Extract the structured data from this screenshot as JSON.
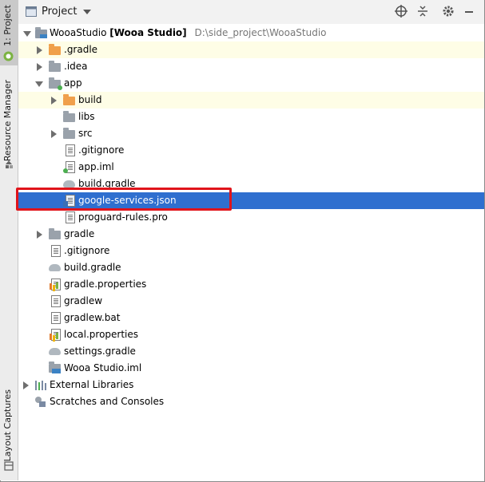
{
  "side_tabs": {
    "project": "1: Project",
    "resource_manager": "Resource Manager",
    "layout_captures": "Layout Captures"
  },
  "header": {
    "title": "Project",
    "dropdown_icon": "chevron-down-icon",
    "actions": [
      "crosshair-icon",
      "collapse-icon",
      "gear-icon",
      "minimize-icon"
    ]
  },
  "tree": {
    "root_name": "WooaStudio",
    "root_module": "[Wooa Studio]",
    "root_path": "D:\\side_project\\WooaStudio",
    "items": [
      {
        "label": ".gradle"
      },
      {
        "label": ".idea"
      },
      {
        "label": "app"
      },
      {
        "label": "build"
      },
      {
        "label": "libs"
      },
      {
        "label": "src"
      },
      {
        "label": ".gitignore"
      },
      {
        "label": "app.iml"
      },
      {
        "label": "build.gradle"
      },
      {
        "label": "google-services.json"
      },
      {
        "label": "proguard-rules.pro"
      },
      {
        "label": "gradle"
      },
      {
        "label": ".gitignore"
      },
      {
        "label": "build.gradle"
      },
      {
        "label": "gradle.properties"
      },
      {
        "label": "gradlew"
      },
      {
        "label": "gradlew.bat"
      },
      {
        "label": "local.properties"
      },
      {
        "label": "settings.gradle"
      },
      {
        "label": "Wooa Studio.iml"
      },
      {
        "label": "External Libraries"
      },
      {
        "label": "Scratches and Consoles"
      }
    ]
  },
  "colors": {
    "selection": "#2f6fcf",
    "excluded_highlight": "#fefde6",
    "annotation_box": "#e0141b"
  }
}
